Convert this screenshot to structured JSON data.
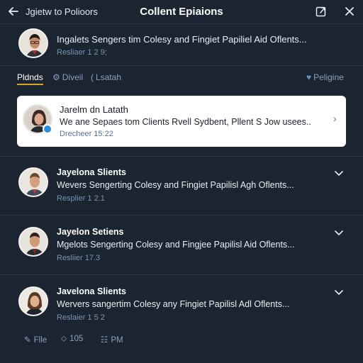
{
  "topbar": {
    "back_icon": "arrow-left-icon",
    "back_label": "Jgietw to Polioors",
    "title": "Collent Epiaions",
    "share_icon": "share-square-icon",
    "close_icon": "close-icon"
  },
  "compose": {
    "text": "Ingalets Sengers tim Colesy and Fingiet Papiliel Aid Oflents...",
    "meta": "Resliaer 1 2 9;"
  },
  "tabs": [
    {
      "label": "Pldnds",
      "icon": ""
    },
    {
      "label": "Diveil",
      "icon": "⚙"
    },
    {
      "label": "Lsatah",
      "icon": "("
    }
  ],
  "tab_right": {
    "label": "Peligine",
    "icon": "♥"
  },
  "card": {
    "name": "Jarelm dn Latath",
    "text": "We ane Sepaes tom Clients Rvell Sydbent, Pllent S Jow usees..",
    "meta": "Drecheer 15:22"
  },
  "items": [
    {
      "name": "Jayelona Slients",
      "text": "Wevers Sengerting Colesy and Fingiet Papilisl Agh Oflents...",
      "meta": "Resplier 1 2.1"
    },
    {
      "name": "Jayelon Setiens",
      "text": "Mgelots Sengerting Colesy and Fingjee Papilisl Aid Oflents...",
      "meta": "Resliier 17.3"
    },
    {
      "name": "Javelona Slients",
      "text": "Wervers sangertim Colesy any Fingiet Papilisl Adl Oflents...",
      "meta": "Reslaier 1 5 2"
    }
  ],
  "footer": [
    {
      "label": "Flle",
      "icon": "✎"
    },
    {
      "label": "105",
      "icon": "⬦"
    },
    {
      "label": "PM",
      "icon": "☷"
    }
  ],
  "colors": {
    "background": "#1b2431",
    "accent": "#d9a520",
    "card": "#ffffff",
    "meta": "#7d92ad"
  }
}
